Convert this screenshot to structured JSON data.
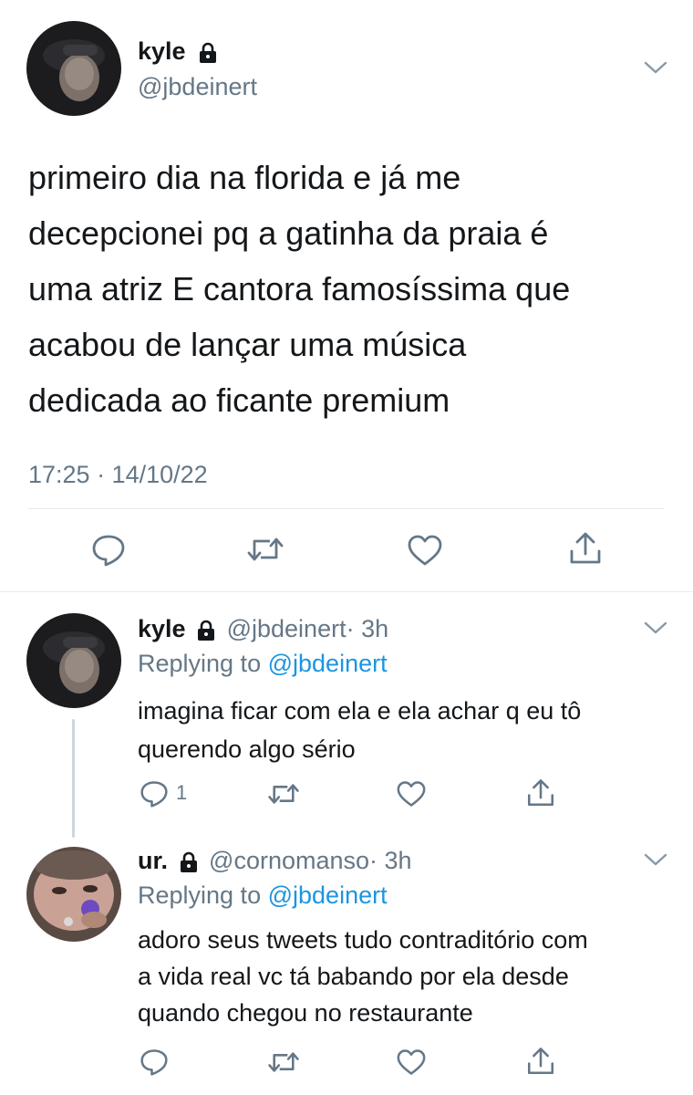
{
  "main_tweet": {
    "author_name": "kyle",
    "author_handle": "@jbdeinert",
    "text_lines": [
      "primeiro dia na florida e já me",
      "decepcionei pq a gatinha da praia é",
      "uma atriz E cantora famosíssima que",
      "acabou de lançar uma música",
      "dedicada ao ficante premium"
    ],
    "timestamp": "17:25 · 14/10/22",
    "icons": {
      "more": "chevron-down-icon",
      "actions": [
        "reply-icon",
        "retweet-icon",
        "like-icon",
        "share-icon"
      ],
      "verified_lock": "lock-icon"
    }
  },
  "replies": [
    {
      "author_name": "kyle",
      "author_handle": "@jbdeinert",
      "time": "· 3h",
      "replying_prefix": "Replying to",
      "replying_handle": "@jbdeinert",
      "text_lines": [
        "imagina ficar com ela e ela achar q eu tô",
        "querendo algo sério"
      ],
      "reply_count": "1"
    },
    {
      "author_name": "ur.",
      "author_handle": "@cornomanso",
      "time": "· 3h",
      "replying_prefix": "Replying to",
      "replying_handle": "@jbdeinert",
      "text_lines": [
        "adoro seus tweets tudo contraditório com",
        "a vida real vc tá babando por ela desde",
        "quando chegou no restaurante"
      ],
      "reply_count": ""
    }
  ],
  "colors": {
    "text": "#14171a",
    "muted": "#657786",
    "link": "#1b95e0",
    "divider": "#e6ecf0"
  }
}
